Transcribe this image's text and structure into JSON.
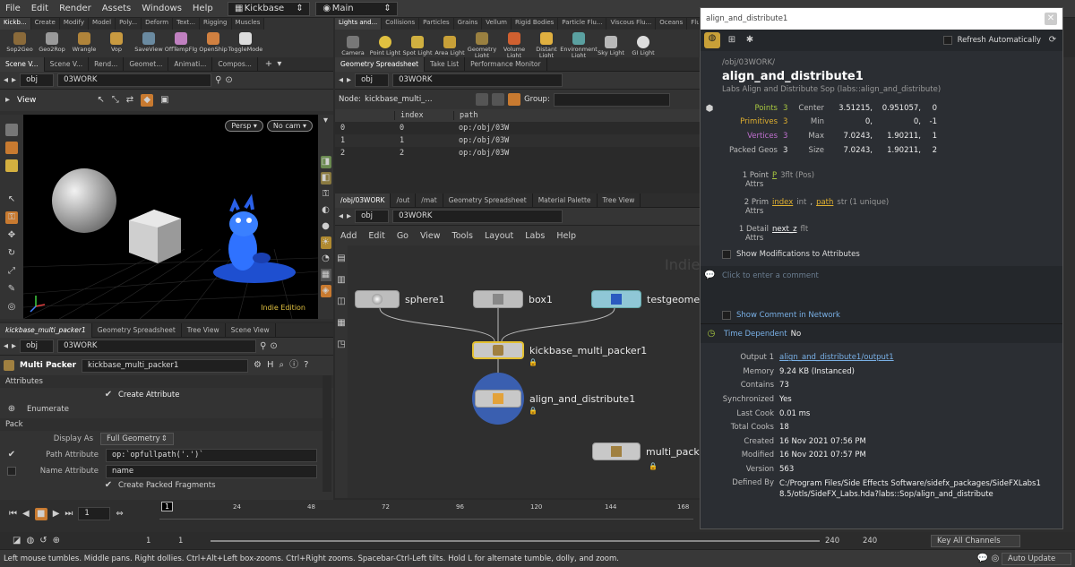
{
  "menubar": {
    "items": [
      "File",
      "Edit",
      "Render",
      "Assets",
      "Windows",
      "Help"
    ],
    "desktop": "Kickbase",
    "context": "Main"
  },
  "shelf_left": {
    "tabs": [
      "Kickb...",
      "Create",
      "Modify",
      "Model",
      "Poly...",
      "Deform",
      "Text...",
      "Rigging",
      "Muscles"
    ],
    "tools": [
      "Sop2Geo",
      "Geo2Rop",
      "Wrangle",
      "Vop",
      "SaveView",
      "OffTempFlg",
      "OpenShip",
      "ToggleMode"
    ]
  },
  "shelf_right": {
    "tabs": [
      "Lights and...",
      "Collisions",
      "Particles",
      "Grains",
      "Vellum",
      "Rigid Bodies",
      "Particle Flu...",
      "Viscous Flu...",
      "Oceans",
      "Flu..."
    ],
    "tools": [
      "Camera",
      "Point Light",
      "Spot Light",
      "Area Light",
      "Geometry Light",
      "Volume Light",
      "Distant Light",
      "Environment Light",
      "Sky Light",
      "GI Light"
    ]
  },
  "viewer_pane": {
    "tabs": [
      "Scene V...",
      "Scene V...",
      "Rend...",
      "Geomet...",
      "Animati...",
      "Compos..."
    ],
    "path": "obj",
    "network": "03WORK",
    "title": "View",
    "persp": "Persp",
    "cam": "No cam",
    "watermark": "Indie Edition"
  },
  "spreadsheet_pane": {
    "tabs": [
      "Geometry Spreadsheet",
      "Take List",
      "Performance Monitor"
    ],
    "path": "obj",
    "network": "03WORK",
    "node_label": "Node:",
    "node_value": "kickbase_multi_...",
    "group_label": "Group:",
    "columns": [
      "",
      "index",
      "path"
    ],
    "rows": [
      [
        "0",
        "0",
        "op:/obj/03W"
      ],
      [
        "1",
        "1",
        "op:/obj/03W"
      ],
      [
        "2",
        "2",
        "op:/obj/03W"
      ]
    ]
  },
  "network_pane": {
    "tabs": [
      "/obj/03WORK",
      "/out",
      "/mat",
      "Geometry Spreadsheet",
      "Material Palette",
      "Tree View"
    ],
    "path": "obj",
    "network": "03WORK",
    "menu": [
      "Add",
      "Edit",
      "Go",
      "View",
      "Tools",
      "Layout",
      "Labs",
      "Help"
    ],
    "watermark": "Indie",
    "nodes": [
      "sphere1",
      "box1",
      "testgeomet",
      "kickbase_multi_packer1",
      "align_and_distribute1",
      "multi_pack"
    ]
  },
  "params_pane": {
    "tabs": [
      "kickbase_multi_packer1",
      "Geometry Spreadsheet",
      "Tree View",
      "Scene View"
    ],
    "path": "obj",
    "network": "03WORK",
    "type": "Multi Packer",
    "name": "kickbase_multi_packer1",
    "section_attributes": "Attributes",
    "create_attribute": "Create Attribute",
    "enumerate": "Enumerate",
    "section_pack": "Pack",
    "display_as_label": "Display As",
    "display_as_value": "Full Geometry",
    "path_attr_label": "Path Attribute",
    "path_attr_value": "op:`opfullpath('.')`",
    "name_attr_label": "Name Attribute",
    "name_attr_value": "name",
    "create_packed": "Create Packed Fragments"
  },
  "timeline": {
    "frame": "1",
    "marker": "1",
    "ticks": [
      "24",
      "48",
      "72",
      "96",
      "120",
      "144",
      "168"
    ],
    "start": "1",
    "start2": "1",
    "end": "240",
    "end2": "240",
    "keys": "Key All Channels",
    "update": "Auto Update"
  },
  "status": "Left mouse tumbles. Middle pans. Right dollies. Ctrl+Alt+Left box-zooms. Ctrl+Right zooms. Spacebar-Ctrl-Left tilts. Hold L for alternate tumble, dolly, and zoom.",
  "info": {
    "search": "align_and_distribute1",
    "refresh": "Refresh Automatically",
    "path": "/obj/03WORK/",
    "title": "align_and_distribute1",
    "subtitle": "Labs Align and Distribute Sop (labs::align_and_distribute)",
    "stats": [
      {
        "label": "Points",
        "count": "3",
        "color": "#a8c840",
        "key": "Center",
        "vals": [
          "3.51215,",
          "0.951057,",
          "0"
        ]
      },
      {
        "label": "Primitives",
        "count": "3",
        "color": "#e0b030",
        "key": "Min",
        "vals": [
          "0,",
          "0,",
          "-1"
        ]
      },
      {
        "label": "Vertices",
        "count": "3",
        "color": "#c070d0",
        "key": "Max",
        "vals": [
          "7.0243,",
          "1.90211,",
          "1"
        ]
      },
      {
        "label": "Packed Geos",
        "count": "3",
        "color": "#bbbbbb",
        "key": "Size",
        "vals": [
          "7.0243,",
          "1.90211,",
          "2"
        ]
      }
    ],
    "attrs": [
      {
        "head": "1 Point",
        "sub": "Attrs",
        "name": "P",
        "type": "3flt (Pos)"
      },
      {
        "head": "2 Prim",
        "sub": "Attrs",
        "name": "index",
        "type": "int",
        "name2": "path",
        "type2": "str (1 unique)"
      },
      {
        "head": "1 Detail",
        "sub": "Attrs",
        "name": "next_z",
        "type": "flt"
      }
    ],
    "show_mods": "Show Modifications to Attributes",
    "comment": "Click to enter a comment",
    "show_comment": "Show Comment in Network",
    "time_dep_label": "Time Dependent",
    "time_dep_value": "No",
    "details": [
      {
        "k": "Output 1",
        "v": "align_and_distribute1/output1",
        "link": true
      },
      {
        "k": "Memory",
        "v": "9.24 KB (Instanced)"
      },
      {
        "k": "Contains",
        "v": "73"
      },
      {
        "k": "Synchronized",
        "v": "Yes"
      },
      {
        "k": "Last Cook",
        "v": "0.01 ms"
      },
      {
        "k": "Total Cooks",
        "v": "18"
      },
      {
        "k": "Created",
        "v": "16 Nov 2021 07:56 PM"
      },
      {
        "k": "Modified",
        "v": "16 Nov 2021 07:57 PM"
      },
      {
        "k": "Version",
        "v": "563"
      }
    ],
    "defined_by_label": "Defined By",
    "defined_by": "C:/Program Files/Side Effects Software/sidefx_packages/SideFXLabs18.5/otls/SideFX_Labs.hda?labs::Sop/align_and_distribute"
  },
  "colors": {
    "accent": "#e3a23a",
    "link": "#79b0e6",
    "panel": "#2b2e33"
  }
}
